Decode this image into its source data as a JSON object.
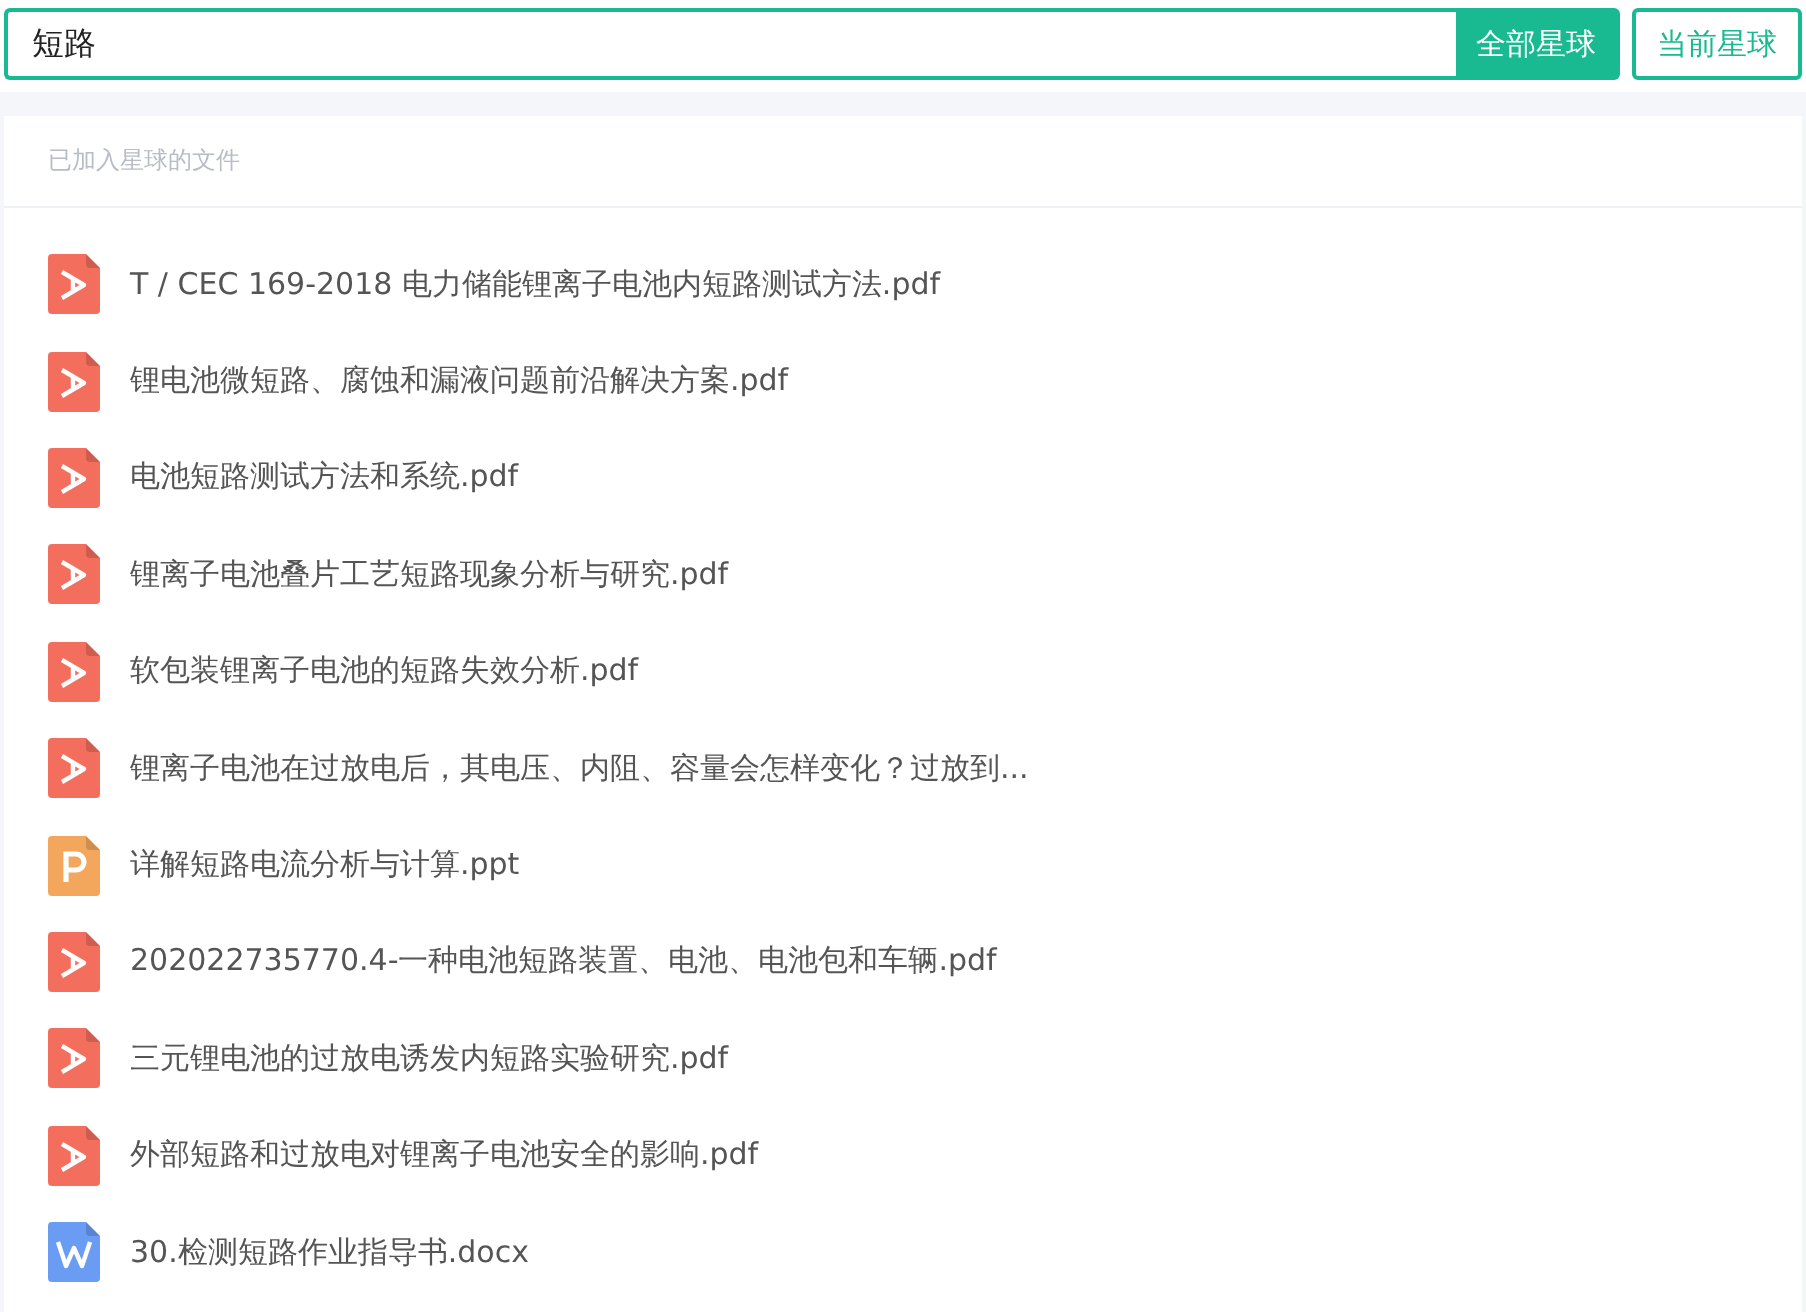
{
  "search": {
    "value": "短路"
  },
  "scope_buttons": [
    {
      "label": "全部星球",
      "selected": true
    },
    {
      "label": "当前星球",
      "selected": false
    }
  ],
  "section_title": "已加入星球的文件",
  "files": [
    {
      "kind": "pdf",
      "name": "T / CEC 169-2018 电力储能锂离子电池内短路测试方法.pdf"
    },
    {
      "kind": "pdf",
      "name": "锂电池微短路、腐蚀和漏液问题前沿解决方案.pdf"
    },
    {
      "kind": "pdf",
      "name": "电池短路测试方法和系统.pdf"
    },
    {
      "kind": "pdf",
      "name": "锂离子电池叠片工艺短路现象分析与研究.pdf"
    },
    {
      "kind": "pdf",
      "name": "软包装锂离子电池的短路失效分析.pdf"
    },
    {
      "kind": "pdf",
      "name": "锂离子电池在过放电后，其电压、内阻、容量会怎样变化？过放到..."
    },
    {
      "kind": "ppt",
      "name": "详解短路电流分析与计算.ppt"
    },
    {
      "kind": "pdf",
      "name": "202022735770.4-一种电池短路装置、电池、电池包和车辆.pdf"
    },
    {
      "kind": "pdf",
      "name": "三元锂电池的过放电诱发内短路实验研究.pdf"
    },
    {
      "kind": "pdf",
      "name": "外部短路和过放电对锂离子电池安全的影响.pdf"
    },
    {
      "kind": "doc",
      "name": "30.检测短路作业指导书.docx"
    }
  ]
}
